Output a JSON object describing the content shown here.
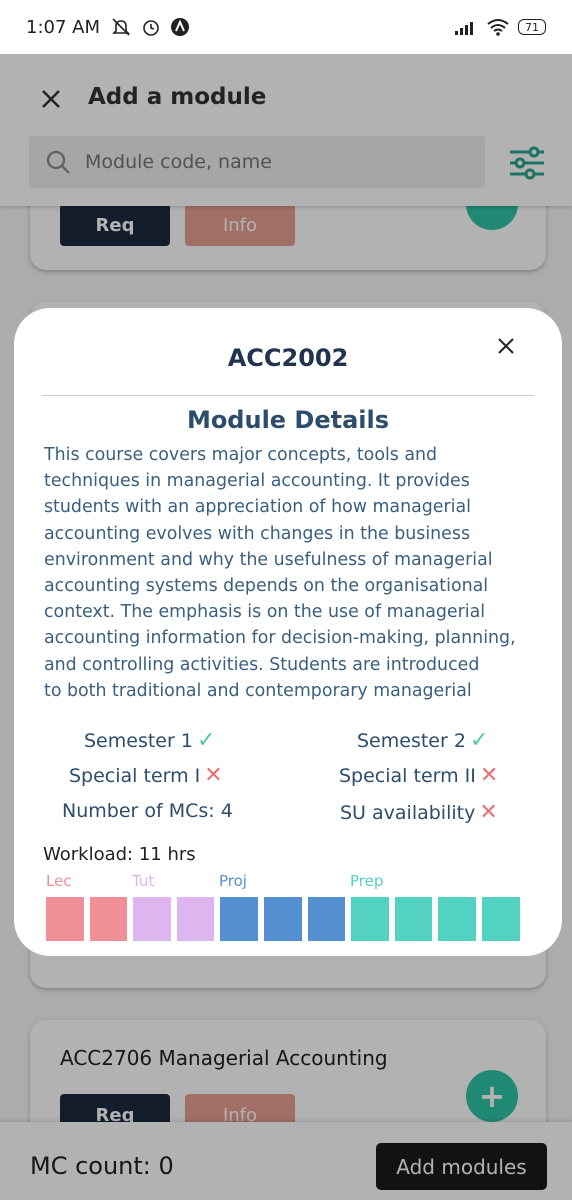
{
  "status_bar": {
    "time": "1:07 AM",
    "battery": "71"
  },
  "header": {
    "title": "Add a module",
    "search_placeholder": "Module code, name"
  },
  "cards": {
    "top": {
      "req_label": "Req",
      "info_label": "Info"
    },
    "bottom": {
      "title": "ACC2706 Managerial Accounting",
      "req_label": "Req",
      "info_label": "Info",
      "add_symbol": "+"
    }
  },
  "bottom_bar": {
    "mc_count": "MC count: 0",
    "add_modules_label": "Add modules"
  },
  "modal": {
    "code": "ACC2002",
    "section_title": "Module Details",
    "description_lines": [
      "This course covers major concepts, tools and",
      "techniques in managerial accounting. It provides",
      "students with an appreciation of how managerial",
      "accounting evolves with changes in the business",
      "environment and why the usefulness of managerial",
      "accounting systems depends on the organisational",
      "context. The emphasis is on the use of managerial",
      "accounting information for decision-making, planning,",
      "and controlling activities. Students are introduced",
      "to both traditional and contemporary managerial"
    ],
    "attributes": {
      "semester1": "Semester 1",
      "semester2": "Semester 2",
      "special_term1": "Special term I",
      "special_term2": "Special term II",
      "mcs": "Number of MCs: 4",
      "su": "SU availability"
    },
    "workload": {
      "label": "Workload: 11 hrs",
      "legend": {
        "lec": "Lec",
        "tut": "Tut",
        "proj": "Proj",
        "prep": "Prep"
      },
      "hours": {
        "lec": 2,
        "tut": 2,
        "proj": 3,
        "prep": 4
      },
      "colors": {
        "lec": "#f08f96",
        "tut": "#ddb5ef",
        "proj": "#5590d2",
        "prep": "#54d2c1"
      }
    }
  },
  "colors": {
    "accent": "#2ec4a5",
    "req_button": "#1c2a3f",
    "info_button": "#e8a093",
    "check": "#4ec9a4",
    "cross": "#e8707a"
  }
}
